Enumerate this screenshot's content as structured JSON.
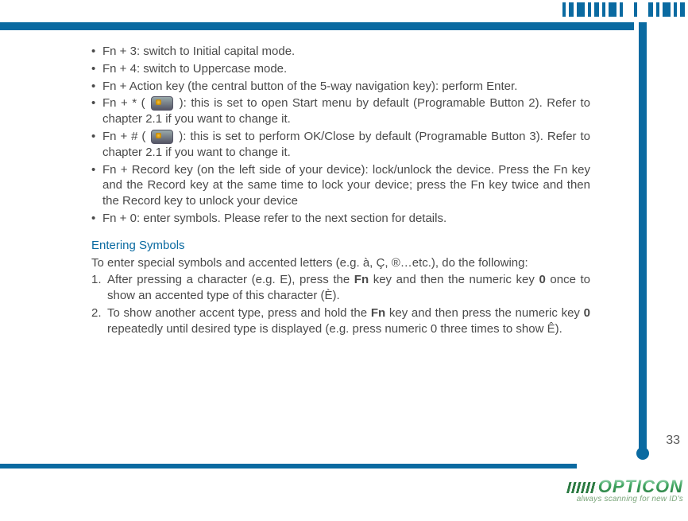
{
  "shortcuts": [
    {
      "text": "Fn + 3: switch to Initial capital mode."
    },
    {
      "text": "Fn + 4: switch to Uppercase mode."
    },
    {
      "text": "Fn + Action key (the central button of the 5-way navigation key): perform Enter."
    },
    {
      "pre": "Fn + * ( ",
      "icon": "start-menu-key-icon",
      "post": " ): this is set to open Start menu by default (Programable Button 2). Refer to chapter 2.1 if you want to change it."
    },
    {
      "pre": "Fn + # ( ",
      "icon": "ok-close-key-icon",
      "post": " ): this is set to perform OK/Close by default (Programable Button 3). Refer to chapter 2.1 if you want to change it."
    },
    {
      "text": "Fn + Record key (on the left side of your device): lock/unlock the device. Press the Fn key and the Record key at the same time to lock your device; press the Fn key twice and then the Record key to unlock your device"
    },
    {
      "text": "Fn + 0: enter symbols. Please refer to the next section for details."
    }
  ],
  "symbols": {
    "title": "Entering Symbols",
    "intro": "To enter special symbols and accented letters (e.g. à, Ç, ®…etc.), do the following:",
    "steps": [
      {
        "a": "After pressing a character (e.g. E), press the ",
        "b1": "Fn",
        "c": " key and then the numeric key ",
        "b2": "0",
        "d": " once to show an accented type of this character (È)."
      },
      {
        "a": "To show another accent type, press and hold the ",
        "b1": "Fn",
        "c": " key and then press the numeric key ",
        "b2": "0",
        "d": " repeatedly until desired type is displayed (e.g. press numeric 0 three times to show Ê)."
      }
    ]
  },
  "page_number": "33",
  "brand": {
    "name": "OPTICON",
    "tagline": "always scanning for new ID's"
  }
}
